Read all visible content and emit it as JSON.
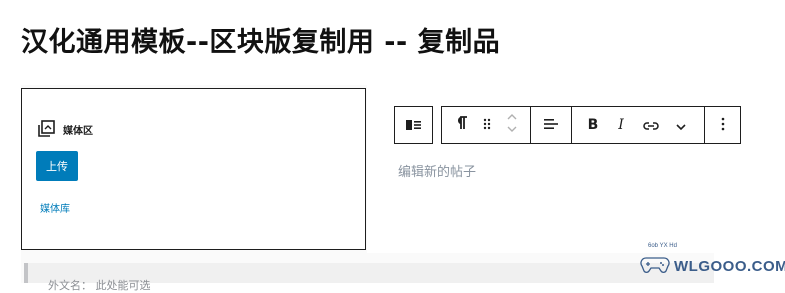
{
  "page": {
    "title": "汉化通用模板--区块版复制用 -- 复制品"
  },
  "media": {
    "label": "媒体区",
    "upload_label": "上传",
    "library_label": "媒体库"
  },
  "toolbar": {
    "block_switcher_icon": "media-text-icon",
    "paragraph_icon": "pilcrow-icon",
    "drag_icon": "drag-handle-icon",
    "move_icon": "chevron-up-down-icon",
    "align_icon": "align-left-icon",
    "bold_label": "B",
    "italic_label": "I",
    "link_icon": "link-icon",
    "more_icon": "chevron-down-icon",
    "options_icon": "more-vertical-icon"
  },
  "editor": {
    "placeholder": "编辑新的帖子"
  },
  "lower_panel": {
    "text": "外文名： 此处能可选"
  },
  "watermark": {
    "text": "WLGOOO.COM",
    "small_text": "6ob YX Hd"
  },
  "colors": {
    "accent": "#007cba",
    "placeholder": "#8a94a0",
    "border": "#1e1e1e"
  }
}
